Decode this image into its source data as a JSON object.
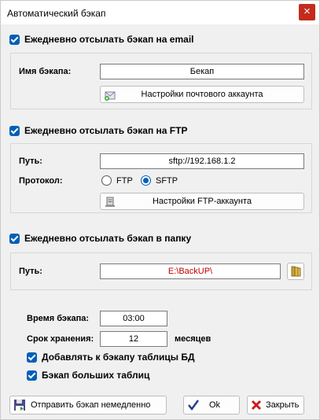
{
  "window": {
    "title": "Автоматический бэкап",
    "close_glyph": "×"
  },
  "email": {
    "checkbox_label": "Ежедневно отсылать бэкап на email",
    "checked": true,
    "name_label": "Имя бэкапа:",
    "name_value": "Бекап",
    "settings_button": "Настройки почтового аккаунта"
  },
  "ftp": {
    "checkbox_label": "Ежедневно отсылать бэкап на FTP",
    "checked": true,
    "path_label": "Путь:",
    "path_value": "sftp://192.168.1.2",
    "protocol_label": "Протокол:",
    "protocol_options": [
      "FTP",
      "SFTP"
    ],
    "protocol_selected": "SFTP",
    "settings_button": "Настройки FTP-аккаунта"
  },
  "folder": {
    "checkbox_label": "Ежедневно отсылать бэкап в папку",
    "checked": true,
    "path_label": "Путь:",
    "path_value": "E:\\BackUP\\"
  },
  "schedule": {
    "time_label": "Время бэкапа:",
    "time_value": "03:00",
    "retention_label": "Срок хранения:",
    "retention_value": "12",
    "retention_unit": "месяцев",
    "db_tables_label": "Добавлять к бэкапу таблицы БД",
    "db_tables_checked": true,
    "big_tables_label": "Бэкап больших таблиц",
    "big_tables_checked": true
  },
  "buttons": {
    "send_now": "Отправить бэкап немедленно",
    "ok": "Ok",
    "close": "Закрыть"
  },
  "colors": {
    "accent": "#005fb8",
    "close_red": "#c42b1c",
    "path_red": "#c00000"
  }
}
